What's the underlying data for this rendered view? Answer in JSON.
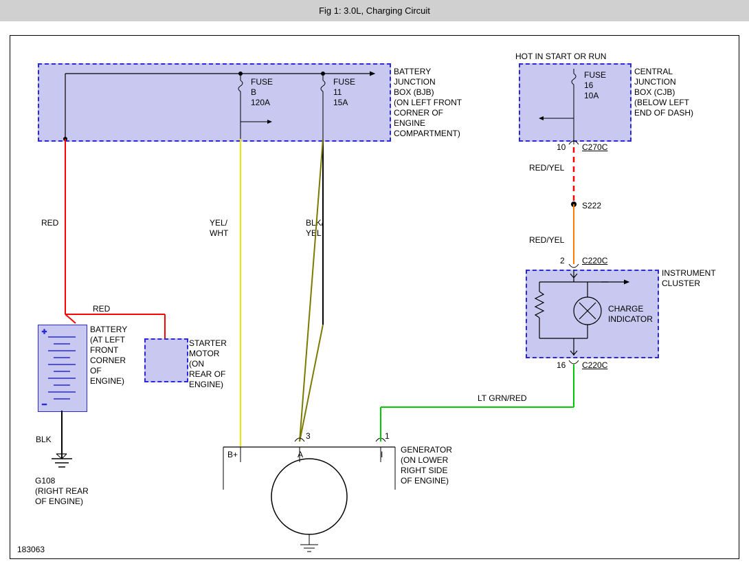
{
  "header": {
    "title": "Fig 1: 3.0L, Charging Circuit"
  },
  "footer": {
    "id": "183063"
  },
  "components": {
    "bjb": {
      "hot_label": "",
      "fuseB": {
        "l1": "FUSE",
        "l2": "B",
        "l3": "120A"
      },
      "fuse11": {
        "l1": "FUSE",
        "l2": "11",
        "l3": "15A"
      },
      "label": "BATTERY\nJUNCTION\nBOX (BJB)\n(ON LEFT FRONT\nCORNER OF\nENGINE\nCOMPARTMENT)"
    },
    "cjb": {
      "hot_label": "HOT IN START OR RUN",
      "fuse16": {
        "l1": "FUSE",
        "l2": "16",
        "l3": "10A"
      },
      "label": "CENTRAL\nJUNCTION\nBOX (CJB)\n(BELOW LEFT\nEND OF DASH)"
    },
    "battery": {
      "label": "BATTERY\n(AT LEFT\nFRONT\nCORNER\nOF\nENGINE)"
    },
    "starter": {
      "label": "STARTER\nMOTOR\n(ON\nREAR OF\nENGINE)"
    },
    "generator": {
      "label": "GENERATOR\n(ON LOWER\nRIGHT SIDE\nOF ENGINE)"
    },
    "cluster": {
      "label": "INSTRUMENT\nCLUSTER",
      "indicator": "CHARGE\nINDICATOR"
    },
    "ground": {
      "label": "G108\n(RIGHT REAR\nOF ENGINE)"
    }
  },
  "wires": {
    "red1": "RED",
    "red2": "RED",
    "yelwht": "YEL/\nWHT",
    "blkyel": "BLK/\nYEL",
    "blk": "BLK",
    "redyel1": "RED/YEL",
    "redyel2": "RED/YEL",
    "ltgrnred": "LT GRN/RED"
  },
  "connectors": {
    "c270c": {
      "pin": "10",
      "name": "C270C"
    },
    "c220c_top": {
      "pin": "2",
      "name": "C220C"
    },
    "c220c_bot": {
      "pin": "16",
      "name": "C220C"
    },
    "s222": "S222",
    "gen_3": "3",
    "gen_1": "1",
    "gen_bplus": "B+",
    "gen_a": "A",
    "gen_i": "I"
  }
}
